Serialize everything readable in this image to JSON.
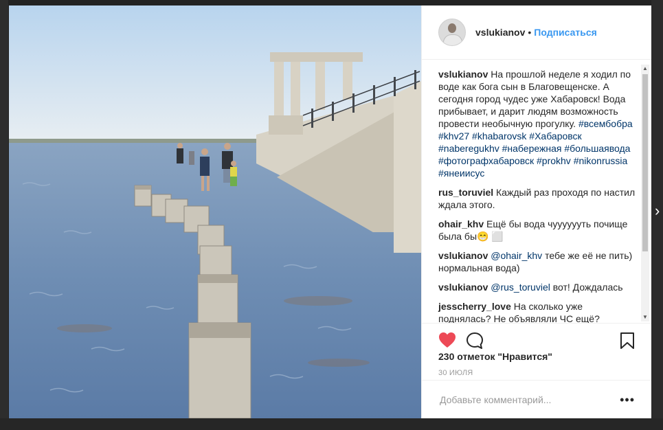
{
  "post": {
    "author": "vslukianov",
    "separator": "•",
    "follow_label": "Подписаться",
    "likes_text": "230 отметок \"Нравится\"",
    "date": "30 ИЮЛЯ",
    "comment_placeholder": "Добавьте комментарий...",
    "more_label": "•••"
  },
  "caption": {
    "user": "vslukianov",
    "text": "На прошлой неделе я ходил по воде как бога сын в Благовещенске. А сегодня город чудес уже Хабаровск! Вода прибывает, и дарит людям возможность провести необычную прогулку.",
    "hashtags": "#всембобра #khv27 #khabarovsk #Хабаровск #naberegukhv #набережная #большаявода #фотографхабаровск #prokhv #nikonrussia #янеиисус"
  },
  "comments": [
    {
      "user": "rus_toruviel",
      "mention": "",
      "text": "Каждый раз проходя по настил ждала этого."
    },
    {
      "user": "ohair_khv",
      "mention": "",
      "text": "Ещё бы вода чууууууть почище была бы😁 ⬜"
    },
    {
      "user": "vslukianov",
      "mention": "@ohair_khv",
      "text": "тебе же её не пить) нормальная вода)"
    },
    {
      "user": "vslukianov",
      "mention": "@rus_toruviel",
      "text": "вот! Дождалась"
    },
    {
      "user": "jesscherry_love",
      "mention": "",
      "text": "На сколько уже поднялась? Не объявляли ЧС ещё?"
    }
  ],
  "icons": {
    "like": "heart-icon",
    "comment": "comment-icon",
    "save": "bookmark-icon",
    "like_color": "#ed4956"
  },
  "colors": {
    "link": "#3897f0",
    "hashtag": "#003569"
  }
}
